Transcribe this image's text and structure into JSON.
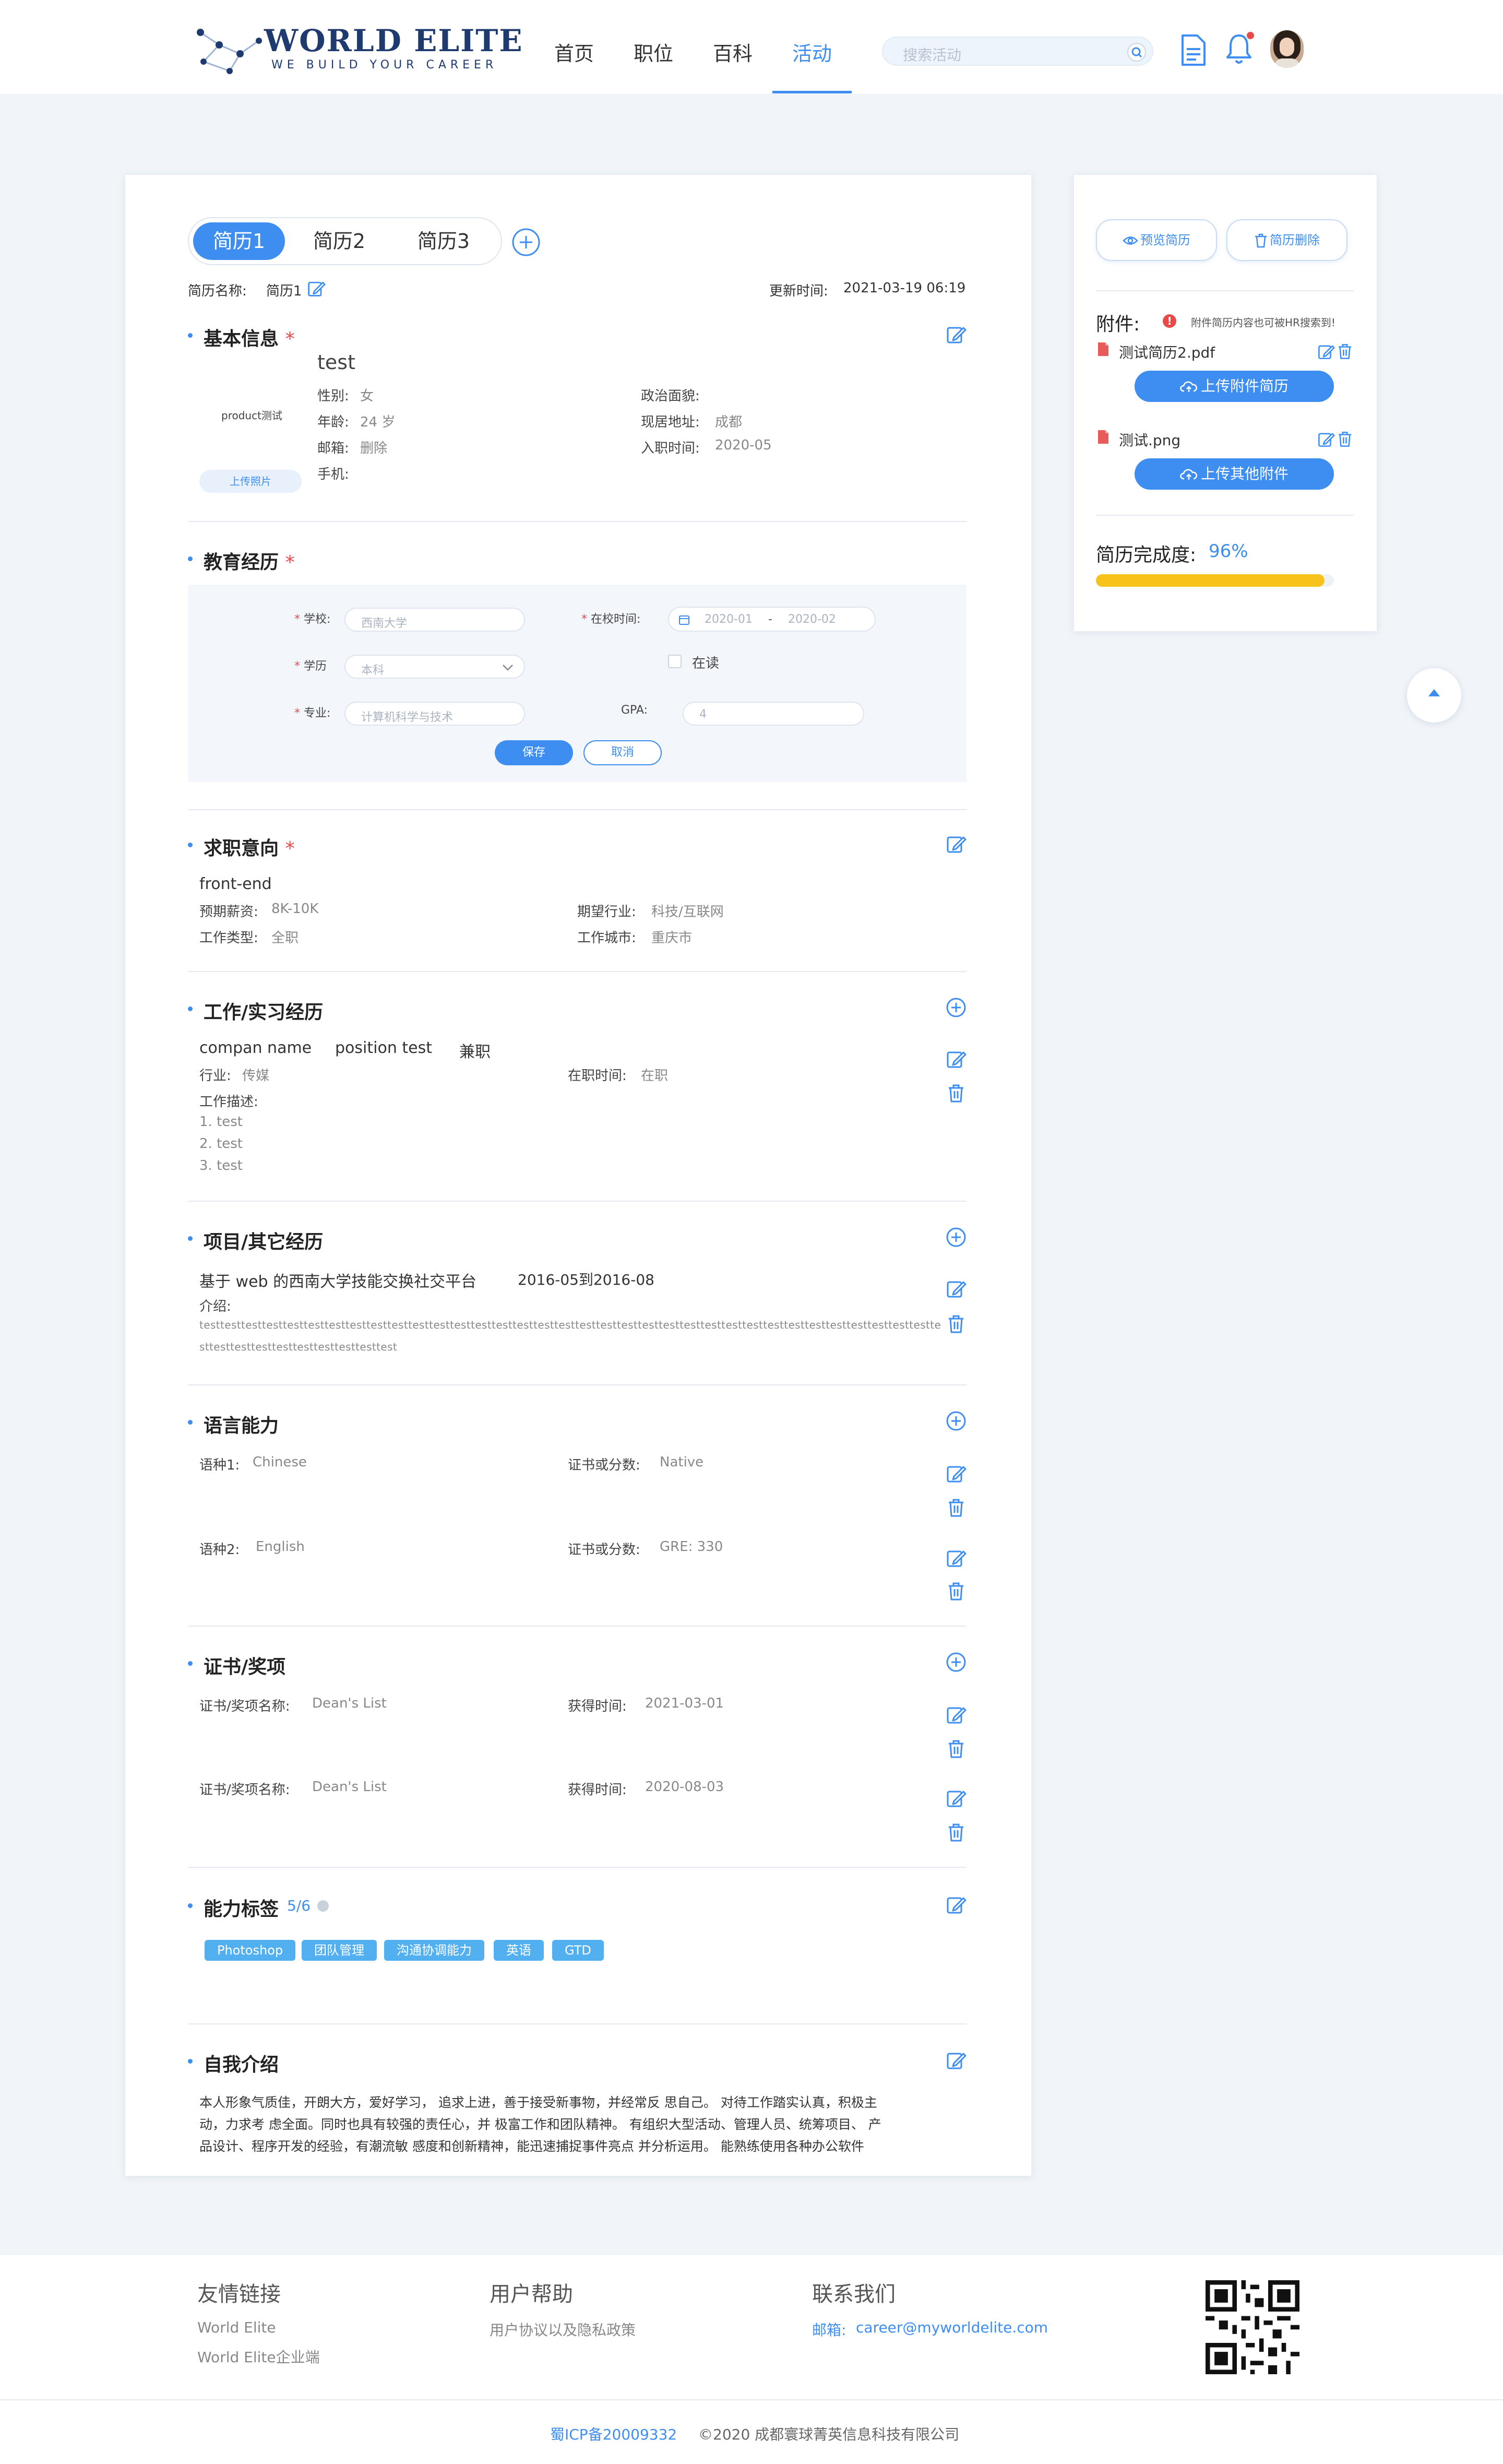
{
  "header": {
    "logo_title": "WORLD ELITE",
    "logo_subtitle": "WE BUILD YOUR CAREER",
    "nav": [
      "首页",
      "职位",
      "百科",
      "活动"
    ],
    "search_placeholder": "搜索活动"
  },
  "resume": {
    "tabs": [
      "简历1",
      "简历2",
      "简历3"
    ],
    "name_label": "简历名称:",
    "name_value": "简历1",
    "update_label": "更新时间:",
    "update_value": "2021-03-19 06:19"
  },
  "basic": {
    "title": "基本信息",
    "photo_alt": "product测试",
    "upload_photo": "上传照片",
    "name": "test",
    "gender_label": "性别:",
    "gender": "女",
    "age_label": "年龄:",
    "age": "24 岁",
    "email_label": "邮箱:",
    "email": "删除",
    "phone_label": "手机:",
    "politics_label": "政治面貌:",
    "address_label": "现居地址:",
    "address": "成都",
    "start_label": "入职时间:",
    "start": "2020-05"
  },
  "education": {
    "title": "教育经历",
    "school_label": "学校:",
    "school": "西南大学",
    "time_label": "在校时间:",
    "time_from": "2020-01",
    "time_to": "2020-02",
    "degree_label": "学历",
    "degree": "本科",
    "studying": "在读",
    "major_label": "专业:",
    "major": "计算机科学与技术",
    "gpa_label": "GPA:",
    "gpa": "4",
    "save": "保存",
    "cancel": "取消"
  },
  "intention": {
    "title": "求职意向",
    "position": "front-end",
    "salary_label": "预期薪资:",
    "salary": "8K-10K",
    "type_label": "工作类型:",
    "type": "全职",
    "industry_label": "期望行业:",
    "industry": "科技/互联网",
    "city_label": "工作城市:",
    "city": "重庆市"
  },
  "work": {
    "title": "工作/实习经历",
    "company": "compan name",
    "position": "position test",
    "kind": "兼职",
    "industry_label": "行业:",
    "industry": "传媒",
    "status_label": "在职时间:",
    "status": "在职",
    "desc_label": "工作描述:",
    "desc": [
      "1. test",
      "2. test",
      "3. test"
    ]
  },
  "project": {
    "title": "项目/其它经历",
    "name": "基于 web 的西南大学技能交换社交平台",
    "period": "2016-05到2016-08",
    "intro_label": "介绍:",
    "intro_line1": "testtesttesttesttesttesttesttesttesttesttesttesttesttesttesttesttesttesttesttesttesttesttesttesttesttesttesttesttesttesttesttesttesttesttestte",
    "intro_line2": "sttesttesttesttesttesttesttesttesttest"
  },
  "language": {
    "title": "语言能力",
    "items": [
      {
        "label": "语种1:",
        "value": "Chinese",
        "cert_label": "证书或分数:",
        "cert": "Native"
      },
      {
        "label": "语种2:",
        "value": "English",
        "cert_label": "证书或分数:",
        "cert": "GRE: 330"
      }
    ]
  },
  "awards": {
    "title": "证书/奖项",
    "items": [
      {
        "label": "证书/奖项名称:",
        "value": "Dean's List",
        "date_label": "获得时间:",
        "date": "2021-03-01"
      },
      {
        "label": "证书/奖项名称:",
        "value": "Dean's List",
        "date_label": "获得时间:",
        "date": "2020-08-03"
      }
    ]
  },
  "skills": {
    "title": "能力标签",
    "count": "5/6",
    "tags": [
      "Photoshop",
      "团队管理",
      "沟通协调能力",
      "英语",
      "GTD"
    ]
  },
  "intro": {
    "title": "自我介绍",
    "lines": [
      "本人形象气质佳，开朗大方，爱好学习，  追求上进，善于接受新事物，并经常反 思自己。 对待工作踏实认真，积极主",
      "动，力求考 虑全面。同时也具有较强的责任心，并 极富工作和团队精神。 有组织大型活动、管理人员、统筹项目、 产",
      "品设计、程序开发的经验，有潮流敏 感度和创新精神，能迅速捕捉事件亮点 并分析运用。 能熟练使用各种办公软件"
    ]
  },
  "sidebar": {
    "preview": "预览简历",
    "delete": "简历删除",
    "attach_title": "附件:",
    "attach_note": "附件简历内容也可被HR搜索到!",
    "file1": "测试简历2.pdf",
    "upload1": "上传附件简历",
    "file2": "测试.png",
    "upload2": "上传其他附件",
    "completion_label": "简历完成度:",
    "completion": "96%",
    "completion_fraction": 0.96
  },
  "footer": {
    "links_title": "友情链接",
    "links": [
      "World Elite",
      "World Elite企业端"
    ],
    "help_title": "用户帮助",
    "help_link": "用户协议以及隐私政策",
    "contact_title": "联系我们",
    "email_label": "邮箱:",
    "email": "career@myworldelite.com",
    "icp": "蜀ICP备20009332",
    "copyright": "©2020 成都寰球菁英信息科技有限公司"
  },
  "colors": {
    "accent": "#3d8ef0",
    "tag": "#52b0f0",
    "progress": "#f7c31b",
    "required": "#e84a4a"
  }
}
